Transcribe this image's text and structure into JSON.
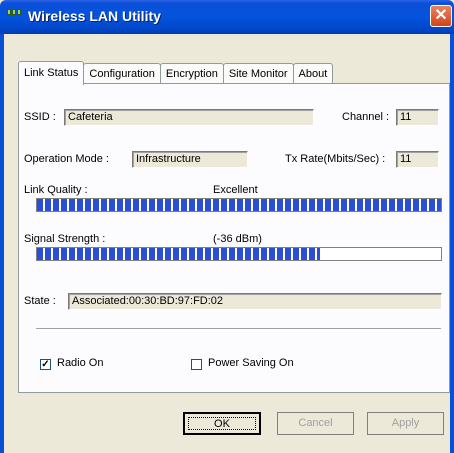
{
  "window": {
    "title": "Wireless LAN Utility",
    "close_glyph": "✕"
  },
  "tabs": [
    {
      "label": "Link Status"
    },
    {
      "label": "Configuration"
    },
    {
      "label": "Encryption"
    },
    {
      "label": "Site Monitor"
    },
    {
      "label": "About"
    }
  ],
  "status": {
    "ssid_label": "SSID :",
    "ssid_value": "Cafeteria",
    "channel_label": "Channel :",
    "channel_value": "11",
    "opmode_label": "Operation Mode :",
    "opmode_value": "Infrastructure",
    "txrate_label": "Tx Rate(Mbits/Sec) :",
    "txrate_value": "11",
    "link_quality_label": "Link Quality :",
    "link_quality_text": "Excellent",
    "link_quality_fraction": 1.0,
    "signal_label": "Signal Strength :",
    "signal_text": "(-36 dBm)",
    "signal_fraction": 0.7,
    "state_label": "State :",
    "state_value": "Associated:00:30:BD:97:FD:02"
  },
  "options": {
    "radio_on_label": "Radio On",
    "radio_on_checked": true,
    "power_saving_label": "Power Saving On",
    "power_saving_checked": false
  },
  "buttons": {
    "ok": "OK",
    "cancel": "Cancel",
    "apply": "Apply"
  },
  "colors": {
    "titlebar": "#0553de",
    "progress": "#2a4fd6",
    "dialog": "#ece9d8"
  }
}
